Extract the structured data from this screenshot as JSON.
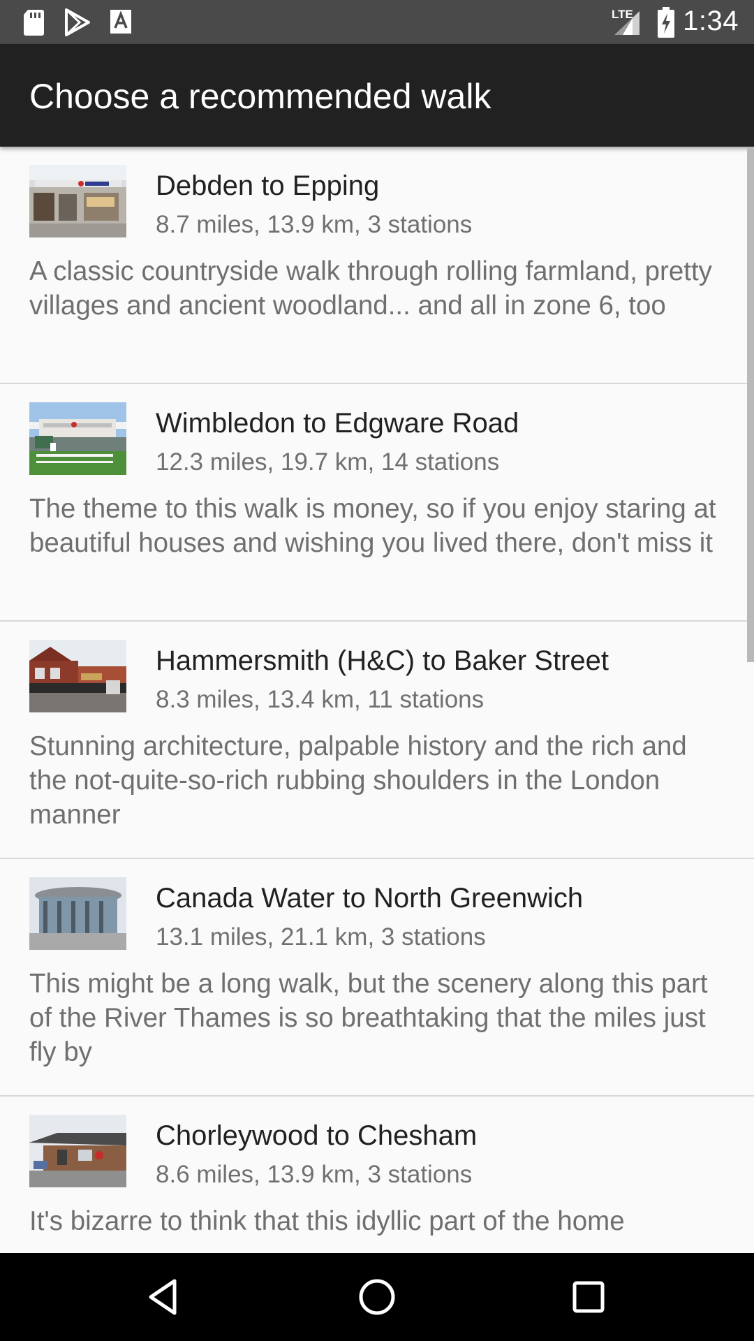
{
  "status_bar": {
    "network": "LTE",
    "time": "1:34",
    "icons": [
      "sd-card-icon",
      "play-store-icon",
      "font-a-icon",
      "signal-icon",
      "battery-charging-icon"
    ]
  },
  "app_bar": {
    "title": "Choose a recommended walk"
  },
  "walks": [
    {
      "name": "Debden to Epping",
      "stats": "8.7 miles, 13.9 km, 3 stations",
      "description": "A classic countryside walk through rolling farmland, pretty villages and ancient woodland... and all in zone 6, too",
      "thumbnail": "debden-station-photo"
    },
    {
      "name": "Wimbledon to Edgware Road",
      "stats": "12.3 miles, 19.7 km, 14 stations",
      "description": "The theme to this walk is money, so if you enjoy staring at beautiful houses and wishing you lived there, don't miss it",
      "thumbnail": "wimbledon-station-photo"
    },
    {
      "name": "Hammersmith (H&C) to Baker Street",
      "stats": "8.3 miles, 13.4 km, 11 stations",
      "description": "Stunning architecture, palpable history and the rich and the not-quite-so-rich rubbing shoulders in the London manner",
      "thumbnail": "hammersmith-station-photo"
    },
    {
      "name": "Canada Water to North Greenwich",
      "stats": "13.1 miles, 21.1 km, 3 stations",
      "description": "This might be a long walk, but the scenery along this part of the River Thames is so breathtaking that the miles just fly by",
      "thumbnail": "canada-water-station-photo"
    },
    {
      "name": "Chorleywood to Chesham",
      "stats": "8.6 miles, 13.9 km, 3 stations",
      "description": "It's bizarre to think that this idyllic part of the home",
      "thumbnail": "chorleywood-station-photo"
    }
  ],
  "nav_bar": {
    "buttons": [
      "back-icon",
      "home-icon",
      "recents-icon"
    ]
  },
  "colors": {
    "status_bar": "#4a4a4a",
    "app_bar": "#212121",
    "background": "#fafafa",
    "nav_bar": "#000000"
  }
}
